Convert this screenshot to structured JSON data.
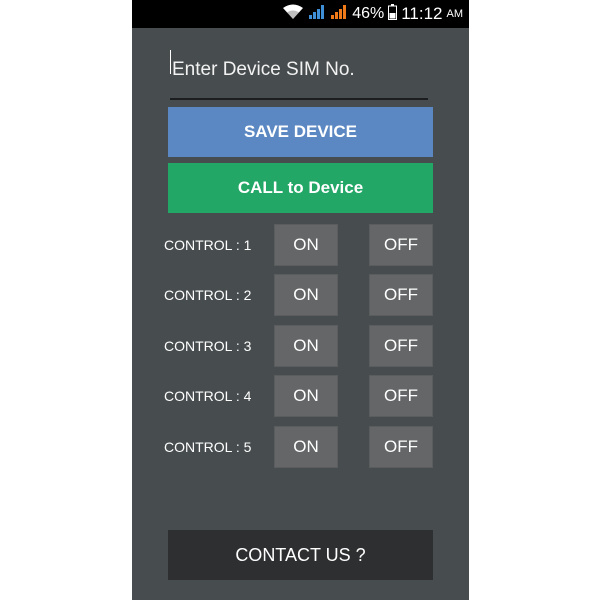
{
  "status_bar": {
    "battery": "46%",
    "time": "11:12",
    "ampm": "AM",
    "icons": [
      "wifi-icon",
      "signal-icon",
      "signal-icon",
      "battery-icon"
    ],
    "signal_color_1": "#3f8fd8",
    "signal_color_2": "#f07a1a"
  },
  "sim_field": {
    "placeholder": "Enter Device SIM No.",
    "value": ""
  },
  "buttons": {
    "save_label": "SAVE DEVICE",
    "call_label": "CALL to Device",
    "contact_label": "CONTACT US ?"
  },
  "controls": [
    {
      "label": "CONTROL : 1",
      "on": "ON",
      "off": "OFF"
    },
    {
      "label": "CONTROL : 2",
      "on": "ON",
      "off": "OFF"
    },
    {
      "label": "CONTROL : 3",
      "on": "ON",
      "off": "OFF"
    },
    {
      "label": "CONTROL : 4",
      "on": "ON",
      "off": "OFF"
    },
    {
      "label": "CONTROL : 5",
      "on": "ON",
      "off": "OFF"
    }
  ],
  "colors": {
    "background": "#474c4e",
    "save": "#5b87c2",
    "call": "#22a767",
    "toggle": "#646667",
    "contact": "#2e2f30"
  }
}
